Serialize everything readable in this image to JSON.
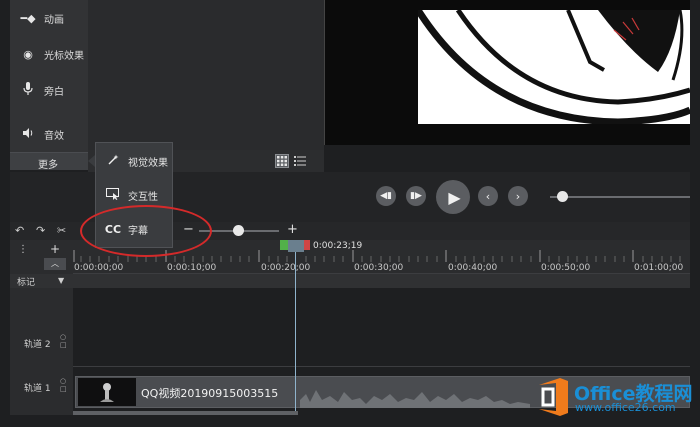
{
  "tool_panel": {
    "items": [
      {
        "icon": "animation-icon",
        "label": "动画"
      },
      {
        "icon": "cursor-effects-icon",
        "label": "光标效果"
      },
      {
        "icon": "microphone-icon",
        "label": "旁白"
      },
      {
        "icon": "audio-icon",
        "label": "音效"
      }
    ],
    "more_label": "更多"
  },
  "more_menu": {
    "items": [
      {
        "icon": "magic-wand-icon",
        "icon_glyph": "",
        "label": "视觉效果"
      },
      {
        "icon": "interactive-icon",
        "icon_glyph": "",
        "label": "交互性"
      },
      {
        "icon": "captions-icon",
        "icon_glyph": "CC",
        "label": "字幕"
      }
    ]
  },
  "timeline": {
    "zoom_minus": "−",
    "zoom_plus": "+",
    "playhead_time": "0:00:23;19",
    "ruler_labels": [
      "0:00:00;00",
      "0:00:10;00",
      "0:00:20;00",
      "0:00:30;00",
      "0:00:40;00",
      "0:00:50;00",
      "0:01:00;00"
    ],
    "markers_label": "标记",
    "tracks": [
      {
        "label": "轨道 2"
      },
      {
        "label": "轨道 1"
      }
    ],
    "clip_title": "QQ视频20190915003515",
    "add_track": "+"
  },
  "watermark": {
    "title": "Office教程网",
    "url": "www.office26.com"
  },
  "colors": {
    "highlight": "#d42a2a",
    "watermark_blue": "#1a8fd6",
    "watermark_orange": "#f07b1c"
  }
}
